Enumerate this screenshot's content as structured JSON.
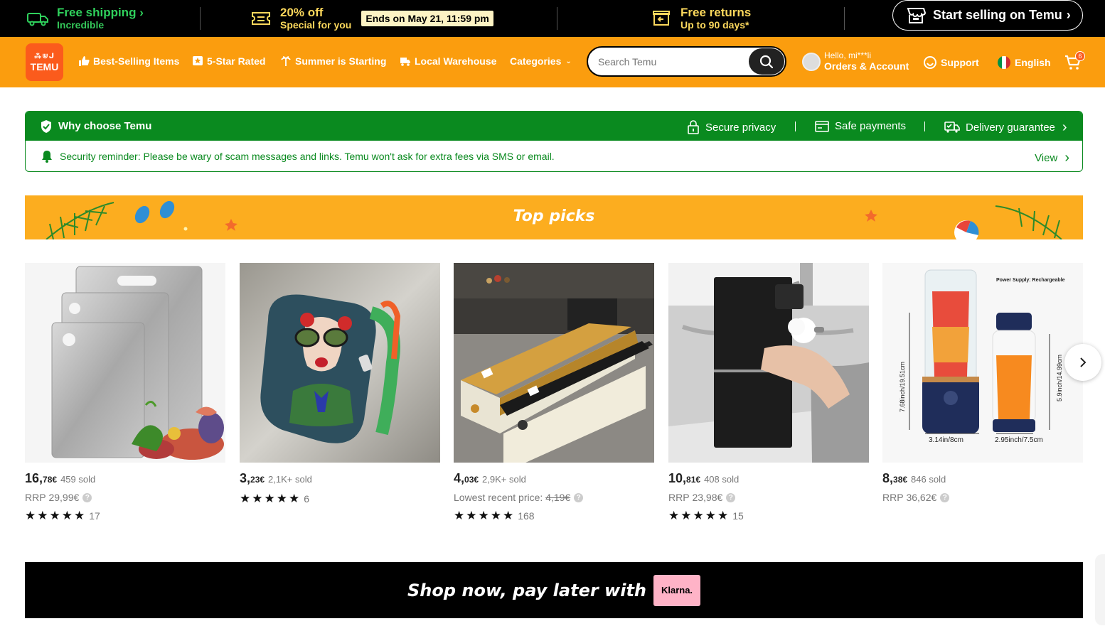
{
  "promo": {
    "shipping": {
      "title": "Free shipping",
      "subtitle": "Incredible"
    },
    "discount": {
      "title": "20% off",
      "subtitle": "Special for you",
      "badge": "Ends on May 21, 11:59 pm"
    },
    "returns": {
      "title": "Free returns",
      "subtitle": "Up to 90 days*"
    },
    "sell_button": "Start selling on Temu"
  },
  "nav": {
    "logo": "TEMU",
    "items": [
      {
        "label": "Best-Selling Items",
        "icon": "thumbs-up-icon"
      },
      {
        "label": "5-Star Rated",
        "icon": "star-badge-icon"
      },
      {
        "label": "Summer is Starting",
        "icon": "palm-tree-icon"
      },
      {
        "label": "Local Warehouse",
        "icon": "truck-icon"
      },
      {
        "label": "Categories",
        "icon": "chevron-down-icon"
      }
    ],
    "search_placeholder": "Search Temu",
    "account_hello": "Hello, mi***li",
    "account_label": "Orders & Account",
    "support": "Support",
    "language": "English",
    "cart_count": "6"
  },
  "why": {
    "title": "Why choose Temu",
    "features": [
      "Secure privacy",
      "Safe payments",
      "Delivery guarantee"
    ],
    "reminder": "Security reminder: Please be wary of scam messages and links. Temu won't ask for extra fees via SMS or email.",
    "view": "View"
  },
  "top_picks": {
    "title": "Top picks"
  },
  "products": [
    {
      "price_int": "16,",
      "price_dec": "78€",
      "sold": "459 sold",
      "ref_label": "RRP",
      "ref_price": "29,99€",
      "ref_strike": false,
      "stars": "★★★★★",
      "reviews": "17"
    },
    {
      "price_int": "3,",
      "price_dec": "23€",
      "sold": "2,1K+ sold",
      "ref_label": "",
      "ref_price": "",
      "ref_strike": false,
      "stars": "★★★★★",
      "reviews": "6"
    },
    {
      "price_int": "4,",
      "price_dec": "03€",
      "sold": "2,9K+ sold",
      "ref_label": "Lowest recent price:",
      "ref_price": "4,19€",
      "ref_strike": true,
      "stars": "★★★★★",
      "reviews": "168"
    },
    {
      "price_int": "10,",
      "price_dec": "81€",
      "sold": "408 sold",
      "ref_label": "RRP",
      "ref_price": "23,98€",
      "ref_strike": false,
      "stars": "★★★★★",
      "reviews": "15"
    },
    {
      "price_int": "8,",
      "price_dec": "38€",
      "sold": "846 sold",
      "ref_label": "RRP",
      "ref_price": "36,62€",
      "ref_strike": false,
      "stars": "",
      "reviews": ""
    }
  ],
  "product_image_text": {
    "blender_supply": "Power Supply: Rechargeable",
    "blender_w1": "3.14in/8cm",
    "blender_w2": "2.95inch/7.5cm",
    "blender_h1": "7.68inch/19.51cm",
    "blender_h2": "5.9inch/14.99cm"
  },
  "klarna": {
    "text": "Shop now, pay later with",
    "logo": "Klarna."
  }
}
